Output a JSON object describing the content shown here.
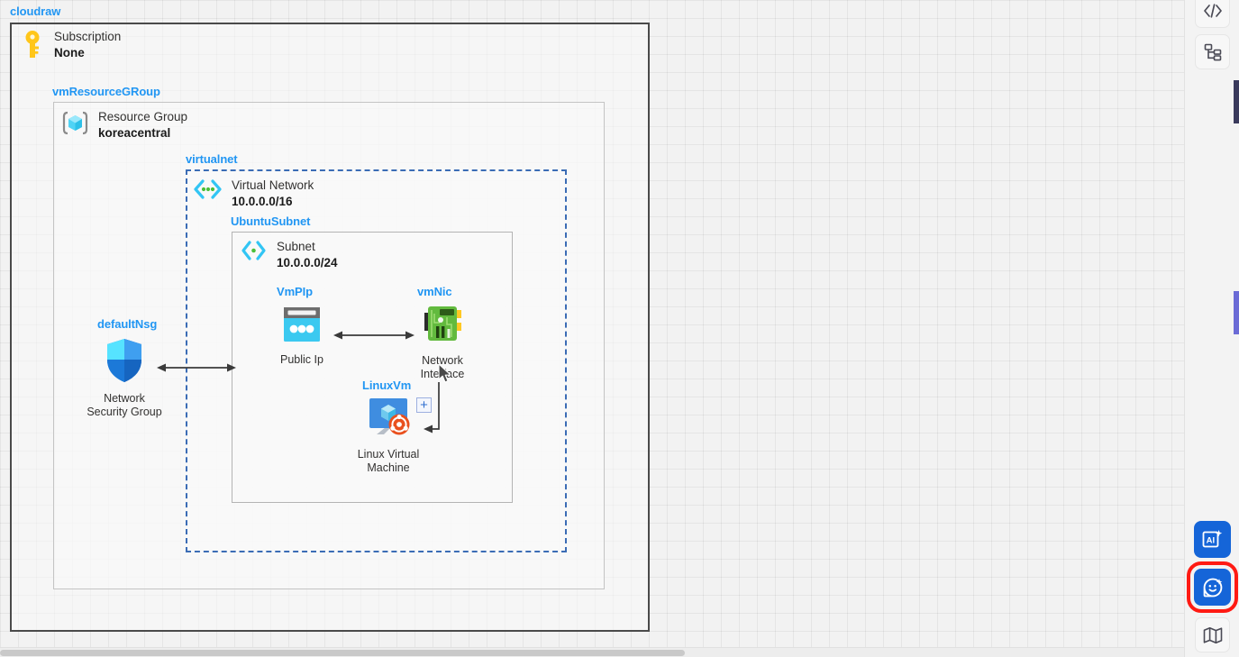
{
  "diagram": {
    "title": "cloudraw",
    "groups": [
      {
        "key": "subscription",
        "label": "cloudraw"
      },
      {
        "key": "resource_group",
        "label": "vmResourceGRoup"
      },
      {
        "key": "vnet",
        "label": "virtualnet"
      },
      {
        "key": "subnet",
        "label": "UbuntuSubnet"
      },
      {
        "key": "public_ip",
        "label": "VmPIp"
      },
      {
        "key": "nic",
        "label": "vmNic"
      },
      {
        "key": "nsg",
        "label": "defaultNsg"
      },
      {
        "key": "vm",
        "label": "LinuxVm"
      }
    ],
    "nodes": {
      "subscription": {
        "type": "Subscription",
        "value": "None",
        "icon": "key-icon"
      },
      "resource_group": {
        "type": "Resource Group",
        "value": "koreacentral",
        "icon": "resource-group-cube-icon"
      },
      "vnet": {
        "type": "Virtual Network",
        "value": "10.0.0.0/16",
        "icon": "virtual-network-icon"
      },
      "subnet": {
        "type": "Subnet",
        "value": "10.0.0.0/24",
        "icon": "subnet-icon"
      },
      "public_ip": {
        "caption": "Public Ip",
        "icon": "public-ip-icon"
      },
      "nic": {
        "caption": "Network Interface",
        "icon": "network-interface-icon"
      },
      "nsg": {
        "caption": "Network Security Group",
        "icon": "shield-icon"
      },
      "vm": {
        "caption": "Linux Virtual Machine",
        "icon": "linux-virtual-machine-icon"
      }
    },
    "add_badge_label": "+",
    "colors": {
      "group_label": "#2196f3",
      "vnet_border": "#3b6cb5",
      "selection": "#ff1a13",
      "accent_button": "#1565d8"
    }
  },
  "toolbar": {
    "top_buttons": [
      {
        "name": "code-view-button",
        "icon": "code-icon",
        "label": "</>"
      },
      {
        "name": "tree-view-button",
        "icon": "tree-icon",
        "label": ""
      }
    ],
    "bottom_buttons": [
      {
        "name": "ai-generate-button",
        "icon": "ai-icon",
        "label": "AI",
        "state": "normal"
      },
      {
        "name": "ai-assistant-button",
        "icon": "smiley-sparkle-icon",
        "label": "",
        "state": "selected"
      },
      {
        "name": "minimap-button",
        "icon": "map-icon",
        "label": "",
        "state": "normal"
      }
    ]
  }
}
